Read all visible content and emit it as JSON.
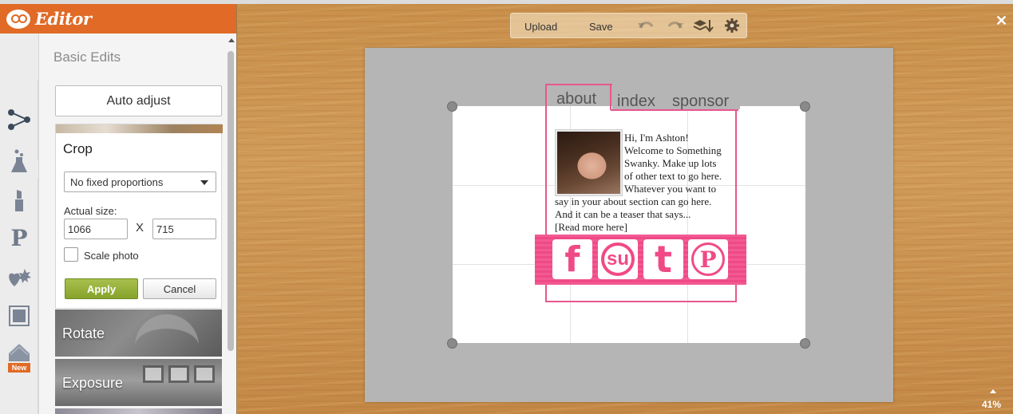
{
  "app": {
    "title": "Editor",
    "accent_color": "#e06a26"
  },
  "rail": {
    "icons": [
      {
        "name": "basic-edits-icon",
        "glyph": "⚬"
      },
      {
        "name": "effects-icon",
        "glyph": "⚗"
      },
      {
        "name": "touch-up-icon",
        "glyph": "❙"
      },
      {
        "name": "text-icon",
        "glyph": "P"
      },
      {
        "name": "overlays-icon",
        "glyph": "♥"
      },
      {
        "name": "frames-icon",
        "glyph": "▣"
      },
      {
        "name": "textures-icon",
        "glyph": "▦"
      }
    ],
    "new_badge": "New"
  },
  "panel": {
    "section_title": "Basic Edits",
    "auto_adjust_label": "Auto adjust",
    "crop": {
      "title": "Crop",
      "proportions_value": "No fixed proportions",
      "actual_size_label": "Actual size:",
      "width_value": "1066",
      "separator": "X",
      "height_value": "715",
      "scale_label": "Scale photo",
      "scale_checked": false,
      "apply_label": "Apply",
      "cancel_label": "Cancel"
    },
    "tiles": [
      {
        "label": "Rotate"
      },
      {
        "label": "Exposure"
      }
    ]
  },
  "toolbar": {
    "upload_label": "Upload",
    "save_label": "Save",
    "icons": {
      "undo": "undo-icon",
      "redo": "redo-icon",
      "layers": "layers-icon",
      "settings": "settings-icon"
    }
  },
  "workspace": {
    "zoom_level": "41%",
    "close_glyph": "✕"
  },
  "canvas": {
    "nav": {
      "about": "about",
      "index": "index",
      "sponsor": "sponsor"
    },
    "bio_lines": [
      "Hi, I'm Ashton!",
      "Welcome to Something",
      "Swanky. Make up lots",
      "of other text to go here.",
      "Whatever you want to",
      "say in your about section can go here.",
      "And it can be a teaser that says...",
      "[Read more here]"
    ],
    "social": [
      {
        "name": "facebook",
        "glyph": "f"
      },
      {
        "name": "stumbleupon",
        "glyph": "su"
      },
      {
        "name": "tumblr",
        "glyph": "t"
      },
      {
        "name": "pinterest",
        "glyph": "P"
      }
    ],
    "pink_color": "#e8578c"
  }
}
